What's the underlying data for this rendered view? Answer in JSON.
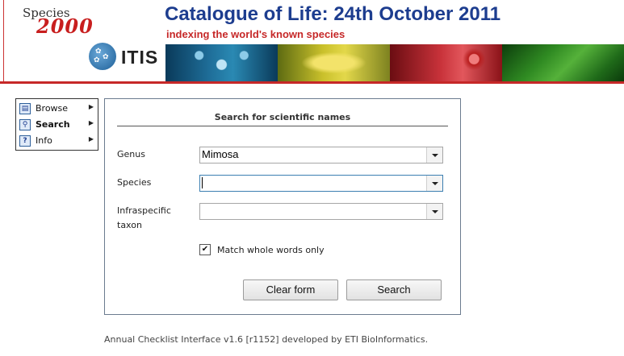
{
  "header": {
    "logo_species": "Species",
    "logo_2000": "2000",
    "itis_logo": "ITIS",
    "title": "Catalogue of Life: 24th October 2011",
    "subtitle": "indexing the world's known species",
    "brand_red": "#c62828",
    "brand_blue": "#1d3d8f"
  },
  "menu": {
    "items": [
      {
        "label": "Browse",
        "icon": "book-icon"
      },
      {
        "label": "Search",
        "icon": "magnifier-icon"
      },
      {
        "label": "Info",
        "icon": "question-icon"
      }
    ]
  },
  "search": {
    "title": "Search for scientific names",
    "genus_label": "Genus",
    "genus_value": "Mimosa",
    "species_label": "Species",
    "species_value": "",
    "infra_label_line1": "Infraspecific",
    "infra_label_line2": "taxon",
    "infra_value": "",
    "match_whole_words": true,
    "match_label": "Match whole words only",
    "clear_label": "Clear form",
    "search_label": "Search"
  },
  "footer": {
    "text": "Annual Checklist Interface v1.6 [r1152] developed by ETI BioInformatics."
  }
}
